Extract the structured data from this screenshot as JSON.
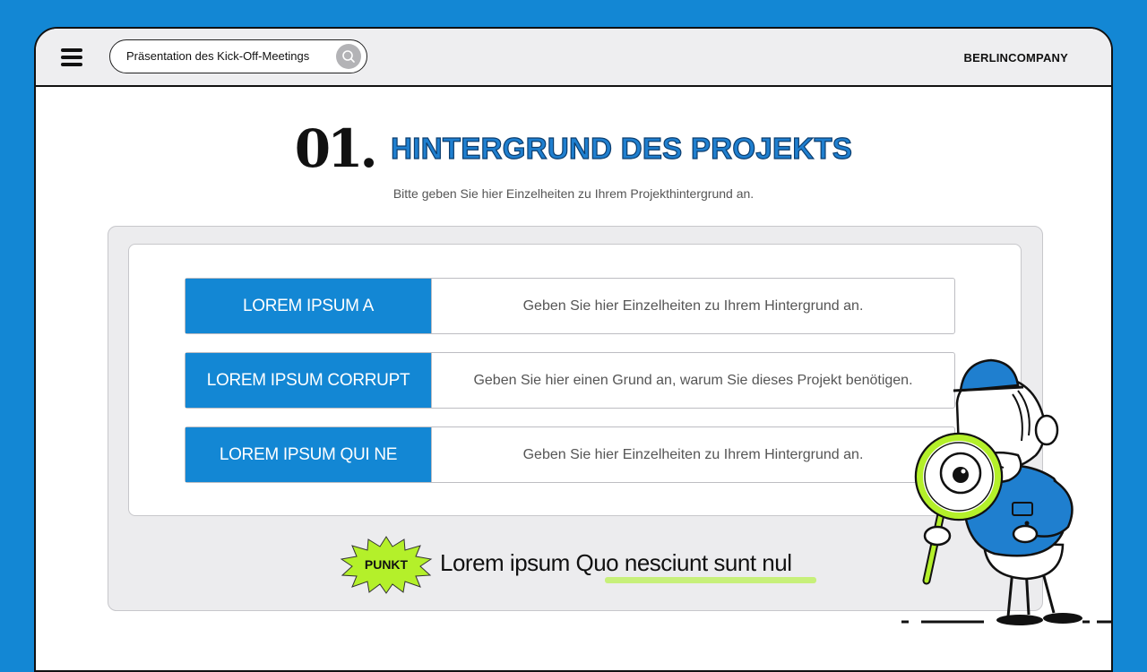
{
  "topbar": {
    "search": {
      "value": "Präsentation des Kick-Off-Meetings"
    },
    "brand": "BERLINCOMPANY"
  },
  "slide": {
    "number": "01.",
    "title": "HINTERGRUND DES PROJEKTS",
    "subtitle": "Bitte geben Sie hier Einzelheiten zu Ihrem Projekthintergrund an.",
    "rows": [
      {
        "label": "LOREM IPSUM A",
        "text": "Geben Sie hier Einzelheiten zu Ihrem Hintergrund an."
      },
      {
        "label": "LOREM IPSUM CORRUPT",
        "text": "Geben Sie hier einen Grund an, warum Sie dieses Projekt benötigen."
      },
      {
        "label": "LOREM IPSUM QUI NE",
        "text": "Geben Sie hier Einzelheiten zu Ihrem Hintergrund an."
      }
    ],
    "punkt": {
      "badge": "PUNKT",
      "text": "Lorem ipsum Quo nesciunt sunt nul"
    }
  },
  "colors": {
    "background": "#1387d4",
    "accent_blue": "#1387d4",
    "lime": "#b4f02a",
    "highlight": "#c7f07a"
  },
  "icons": {
    "menu": "hamburger-menu-icon",
    "search": "search-icon",
    "mascot": "detective-magnifier-illustration"
  }
}
